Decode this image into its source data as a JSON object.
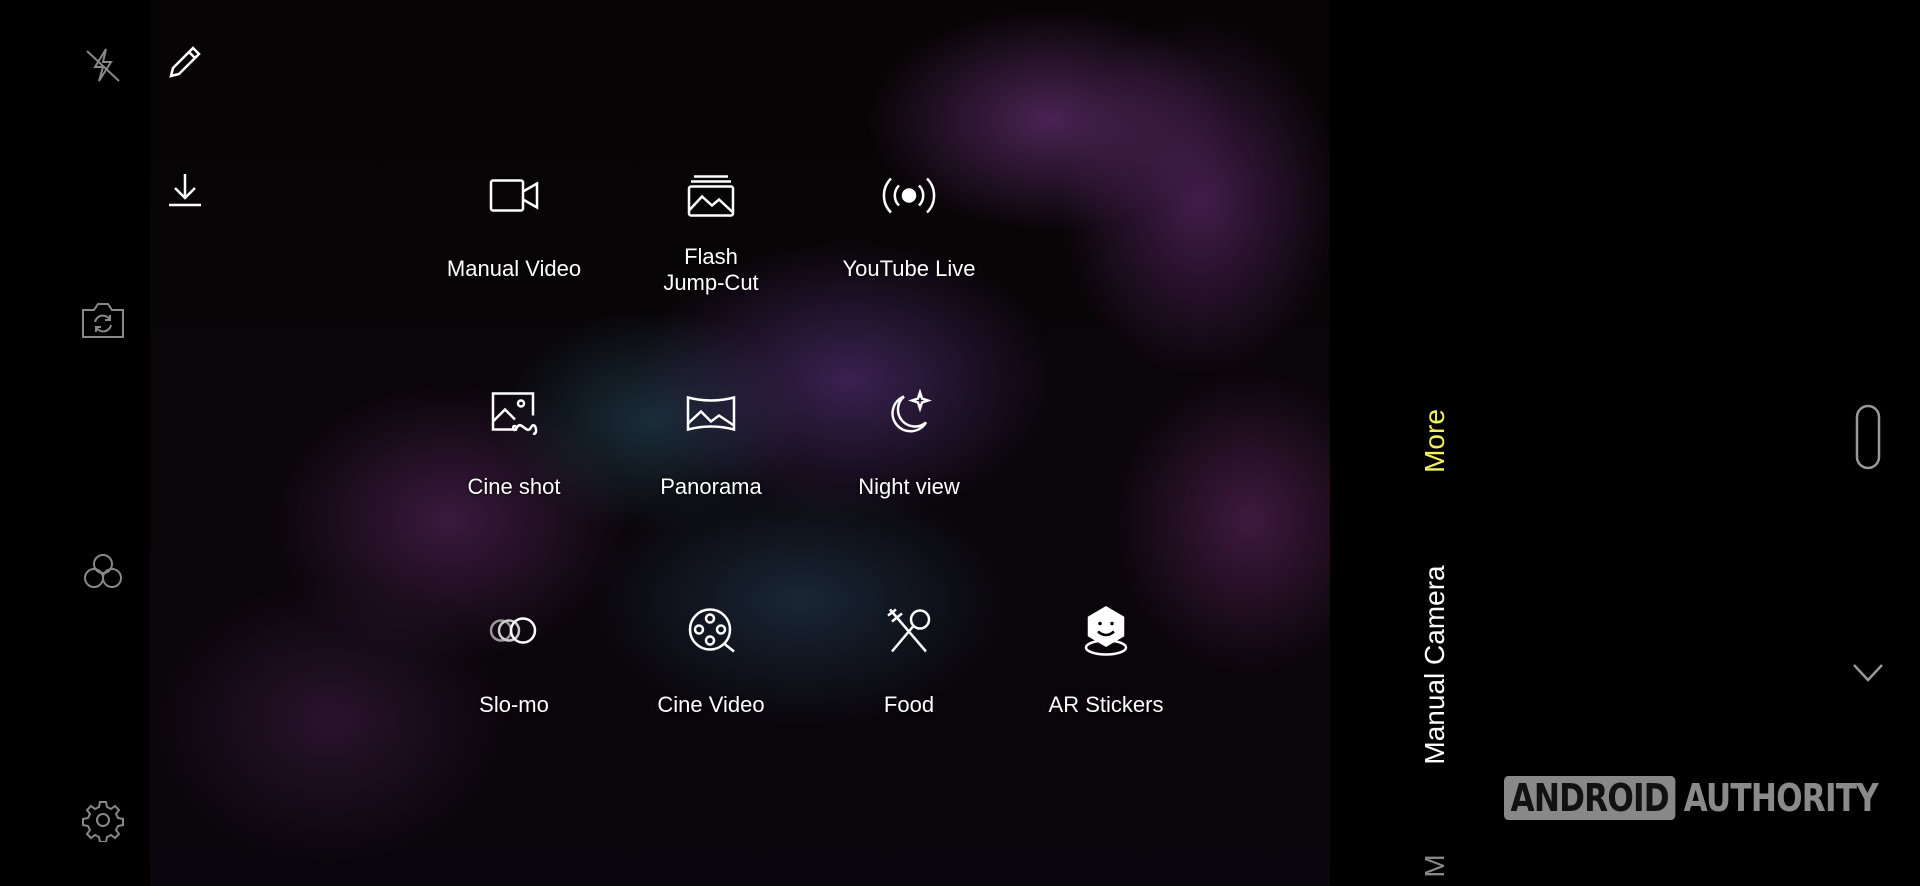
{
  "left_bar": {
    "icons": [
      "flash-off-icon",
      "switch-camera-icon",
      "filter-icon",
      "settings-icon"
    ]
  },
  "viewfinder_tools": {
    "icons": [
      "pencil-icon",
      "download-icon"
    ]
  },
  "modes": [
    {
      "label": "Manual Video",
      "icon": "video-camera-icon"
    },
    {
      "label": "Flash\nJump-Cut",
      "line1": "Flash",
      "line2": "Jump-Cut",
      "icon": "stacked-image-icon"
    },
    {
      "label": "YouTube Live",
      "icon": "broadcast-icon"
    },
    {
      "label": "Cine shot",
      "icon": "image-infinity-icon"
    },
    {
      "label": "Panorama",
      "icon": "panorama-icon"
    },
    {
      "label": "Night view",
      "icon": "moon-star-icon"
    },
    {
      "label": "Slo-mo",
      "icon": "slo-mo-circles-icon"
    },
    {
      "label": "Cine Video",
      "icon": "film-reel-icon"
    },
    {
      "label": "Food",
      "icon": "fork-spoon-icon"
    },
    {
      "label": "AR Stickers",
      "icon": "ar-sticker-icon"
    }
  ],
  "mode_selector": {
    "items": [
      {
        "label": "More",
        "active": true
      },
      {
        "label": "Manual Camera",
        "active": false
      },
      {
        "label": "M",
        "active": false
      }
    ],
    "active_color": "#f2f25a"
  },
  "controls": {
    "shutter": "shutter-pill-icon",
    "collapse": "chevron-down-icon"
  },
  "watermark": {
    "part1": "ANDROID",
    "part2": "AUTHORITY"
  }
}
